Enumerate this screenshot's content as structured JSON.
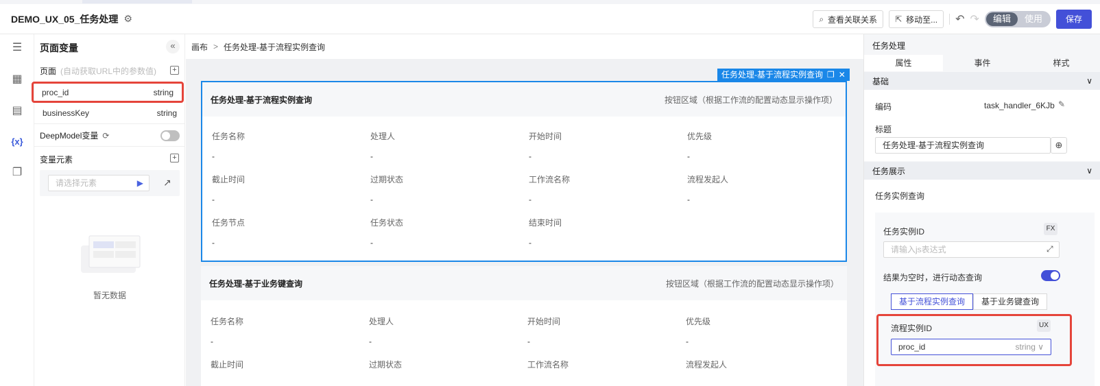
{
  "header": {
    "app_title": "DEMO_UX_05_任务处理",
    "view_relations": "查看关联关系",
    "move_to": "移动至...",
    "mode_edit": "编辑",
    "mode_use": "使用",
    "save": "保存"
  },
  "varpanel": {
    "title": "页面变量",
    "page_section": "页面",
    "page_hint": "(自动获取URL中的参数值)",
    "vars": [
      {
        "name": "proc_id",
        "type": "string"
      },
      {
        "name": "businessKey",
        "type": "string"
      }
    ],
    "deepmodel": "DeepModel变量",
    "element_section": "变量元素",
    "element_placeholder": "请选择元素",
    "empty": "暂无数据"
  },
  "canvas": {
    "breadcrumb_root": "画布",
    "breadcrumb_sep": ">",
    "breadcrumb_current": "任务处理-基于流程实例查询",
    "selected_tag": "任务处理-基于流程实例查询",
    "card1": {
      "title": "任务处理-基于流程实例查询",
      "right": "按钮区域（根据工作流的配置动态显示操作项）",
      "fields": [
        {
          "label": "任务名称",
          "value": "-"
        },
        {
          "label": "处理人",
          "value": "-"
        },
        {
          "label": "开始时间",
          "value": "-"
        },
        {
          "label": "优先级",
          "value": "-"
        },
        {
          "label": "截止时间",
          "value": "-"
        },
        {
          "label": "过期状态",
          "value": "-"
        },
        {
          "label": "工作流名称",
          "value": "-"
        },
        {
          "label": "流程发起人",
          "value": "-"
        },
        {
          "label": "任务节点",
          "value": "-"
        },
        {
          "label": "任务状态",
          "value": "-"
        },
        {
          "label": "结束时间",
          "value": "-"
        }
      ]
    },
    "card2": {
      "title": "任务处理-基于业务键查询",
      "right": "按钮区域（根据工作流的配置动态显示操作项）",
      "fields": [
        {
          "label": "任务名称",
          "value": "-"
        },
        {
          "label": "处理人",
          "value": "-"
        },
        {
          "label": "开始时间",
          "value": "-"
        },
        {
          "label": "优先级",
          "value": "-"
        },
        {
          "label": "截止时间",
          "value": ""
        },
        {
          "label": "过期状态",
          "value": ""
        },
        {
          "label": "工作流名称",
          "value": ""
        },
        {
          "label": "流程发起人",
          "value": ""
        }
      ]
    }
  },
  "rpanel": {
    "title": "任务处理",
    "tabs": [
      "属性",
      "事件",
      "样式"
    ],
    "basic_section": "基础",
    "code_label": "编码",
    "code_value": "task_handler_6KJb",
    "title_label": "标题",
    "title_value": "任务处理-基于流程实例查询",
    "display_section": "任务展示",
    "instance_query": "任务实例查询",
    "instance_id_label": "任务实例ID",
    "fx": "FX",
    "js_placeholder": "请输入js表达式",
    "dynamic_query": "结果为空时，进行动态查询",
    "radio_options": [
      "基于流程实例查询",
      "基于业务键查询"
    ],
    "proc_instance_label": "流程实例ID",
    "ux": "UX",
    "proc_select_value": "proc_id",
    "proc_select_type": "string"
  }
}
